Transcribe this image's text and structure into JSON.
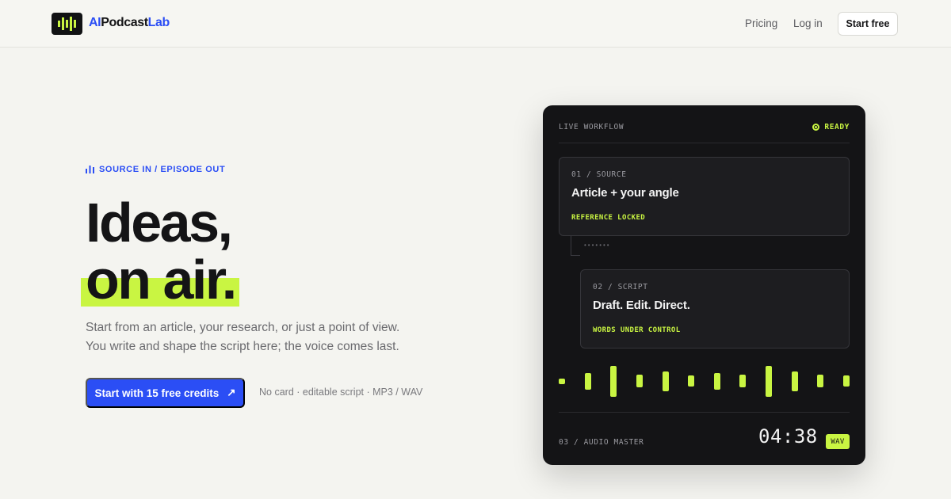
{
  "nav": {
    "brand_prefix": "AI",
    "brand_mid": "Podcast",
    "brand_suffix": "Lab",
    "links": [
      {
        "label": "Pricing"
      },
      {
        "label": "Log in"
      }
    ],
    "cta_label": "Start free"
  },
  "hero": {
    "eyebrow": "SOURCE IN / EPISODE OUT",
    "headline_line1": "Ideas,",
    "headline_line2": "on air.",
    "subtext_line1": "Start from an article, your research, or just a point of view.",
    "subtext_line2": "You write and shape the script here; the voice comes last.",
    "cta_label": "Start with 15 free credits",
    "cta_arrow": "↗",
    "cta_note": "No card · editable script · MP3 / WAV"
  },
  "card": {
    "title": "LIVE WORKFLOW",
    "status": "READY",
    "steps": [
      {
        "number": "01 / SOURCE",
        "title": "Article + your angle",
        "status": "REFERENCE LOCKED"
      },
      {
        "number": "02 / SCRIPT",
        "title": "Draft. Edit. Direct.",
        "status": "WORDS UNDER CONTROL"
      }
    ],
    "connector_dots": "•••••••",
    "waveform_levels": [
      0.15,
      0.45,
      0.85,
      0.35,
      0.55,
      0.3,
      0.45,
      0.35,
      0.85,
      0.55,
      0.35,
      0.3
    ],
    "footer_label": "03 / AUDIO MASTER",
    "timer": "04:38",
    "format_badge": "WAV"
  },
  "colors": {
    "accent": "#c9f542",
    "brand_blue": "#2b4ef5",
    "card_bg": "#141416",
    "page_bg": "#f4f4f0"
  }
}
